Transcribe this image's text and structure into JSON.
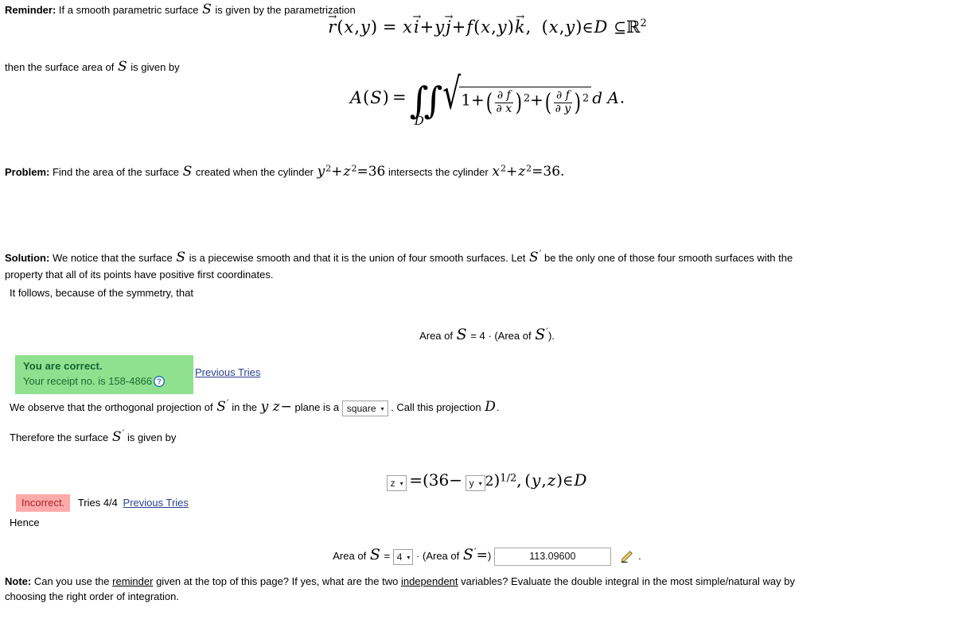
{
  "reminder": {
    "label": "Reminder:",
    "text_before": "If a smooth parametric surface",
    "surface_symbol": "S",
    "text_after": "is given by the parametrization",
    "then_line_a": "then the surface area of",
    "then_line_b": "is given by"
  },
  "equation_param": {
    "r": "r",
    "lparen": "(",
    "x": "x",
    "comma1": ",",
    "y": "y",
    "rparen": ")",
    "eq": "=",
    "x2": "x",
    "i": "i",
    "plus1": "+",
    "y2": "y",
    "j": "j",
    "plus2": "+",
    "f": "f",
    "lparen2": "(",
    "x3": "x",
    "comma2": ",",
    "y3": "y",
    "rparen2": ")",
    "k": "k",
    "comma3": ",",
    "lparen3": "(",
    "x4": "x",
    "comma4": ",",
    "y4": "y",
    "rparen3": ")",
    "in": "∈",
    "D": "D",
    "subseteq": "⊆",
    "R": "ℝ",
    "two": "2"
  },
  "equation_area": {
    "A": "A",
    "lparen": "(",
    "S": "S",
    "rparen": ")",
    "eq": "=",
    "integrals": "∫∫",
    "lower_limit": "D",
    "surd": "√",
    "one": "1",
    "plus1": "+",
    "frac1_num": "∂ f",
    "frac1_den": "∂ x",
    "exp1": "2",
    "plus2": "+",
    "frac2_num": "∂ f",
    "frac2_den": "∂ y",
    "exp2": "2",
    "dA": "d A",
    "period": "."
  },
  "problem": {
    "label": "Problem:",
    "part1": "Find the area of the surface",
    "S": "S",
    "part2": "created when the cylinder",
    "cyl1": {
      "y": "y",
      "sup1": "2",
      "plus": "+",
      "z": "z",
      "sup2": "2",
      "eq": "=",
      "val": "36"
    },
    "part3": "intersects the cylinder",
    "cyl2": {
      "x": "x",
      "sup1": "2",
      "plus": "+",
      "z": "z",
      "sup2": "2",
      "eq": "=",
      "val": "36"
    },
    "period": "."
  },
  "solution": {
    "label": "Solution:",
    "para1_a": "We notice that the surface",
    "S": "S",
    "para1_b": "is a piecewise smooth and that it is the union of four smooth surfaces. Let",
    "Sprime": "S",
    "prime": "′",
    "para1_c": "be the only one of those four smooth surfaces with the",
    "para1_d": "property that all of its points have positive first coordinates.",
    "para2": "It follows, because of the symmetry, that"
  },
  "area_relation": {
    "area_of": "Area of",
    "S": "S",
    "eq": "=",
    "four": "4",
    "dot": "·",
    "lparen_area_of": "(Area of",
    "Sprime": "S",
    "prime": "′",
    "rparen": ").",
    "tail": ")."
  },
  "correct_box": {
    "title": "You are correct.",
    "receipt": "Your receipt no. is 158-4866",
    "help_icon": "help-circle-icon",
    "previous_tries": "Previous Tries",
    "bg_color": "#8FE18F",
    "text_color": "#11622E"
  },
  "observe_line": {
    "part1": "We observe that the orthogonal projection of",
    "Sprime": "S",
    "prime": "′",
    "part2": "in the",
    "yz": "y z",
    "minus": "−",
    "part3": "plane is a",
    "shape_select": {
      "value": "square",
      "caret": "▾"
    },
    "part4": ". Call this projection",
    "D": "D",
    "period": "."
  },
  "therefore_line": {
    "part1": "Therefore the surface",
    "Sprime": "S",
    "prime": "′",
    "part2": "is given by"
  },
  "surface_equation": {
    "var_select_1": {
      "value": "z",
      "caret": "▾"
    },
    "eq": "=",
    "lparen": "(",
    "thirtysix": "36",
    "minus": "−",
    "var_select_2": {
      "value": "y",
      "caret": "▾"
    },
    "two": "2",
    "rparen": ")",
    "exp": "1/2",
    "comma": ",",
    "tuple_l": "(",
    "y": "y",
    "tuple_comma": ",",
    "z": "z",
    "tuple_r": ")",
    "in": "∈",
    "D": "D"
  },
  "incorrect_box": {
    "badge": "Incorrect.",
    "tries": "Tries 4/4",
    "previous_tries": "Previous Tries",
    "bg_color": "#FFAAAA",
    "text_color": "#A7222A"
  },
  "hence": "Hence",
  "final_answer_line": {
    "area_of": "Area of",
    "S": "S",
    "eq": "=",
    "factor_select": {
      "value": "4",
      "caret": "▾"
    },
    "dot": "·",
    "lparen_area_of": "(Area of",
    "Sprime": "S",
    "prime": "′",
    "eq2": "=",
    "rparen": ")",
    "answer_value": "113.09600",
    "answer_placeholder": "",
    "pencil_icon": "pencil-edit-icon",
    "period": "."
  },
  "note": {
    "label": "Note:",
    "text_a": "Can you use the",
    "link_reminder": "reminder",
    "text_b": "given at the top of this page? If yes, what are the two",
    "link_independent": "independent",
    "text_c": "variables? Evaluate the double integral in the most simple/natural way by",
    "text_d": "choosing the right order of integration."
  }
}
